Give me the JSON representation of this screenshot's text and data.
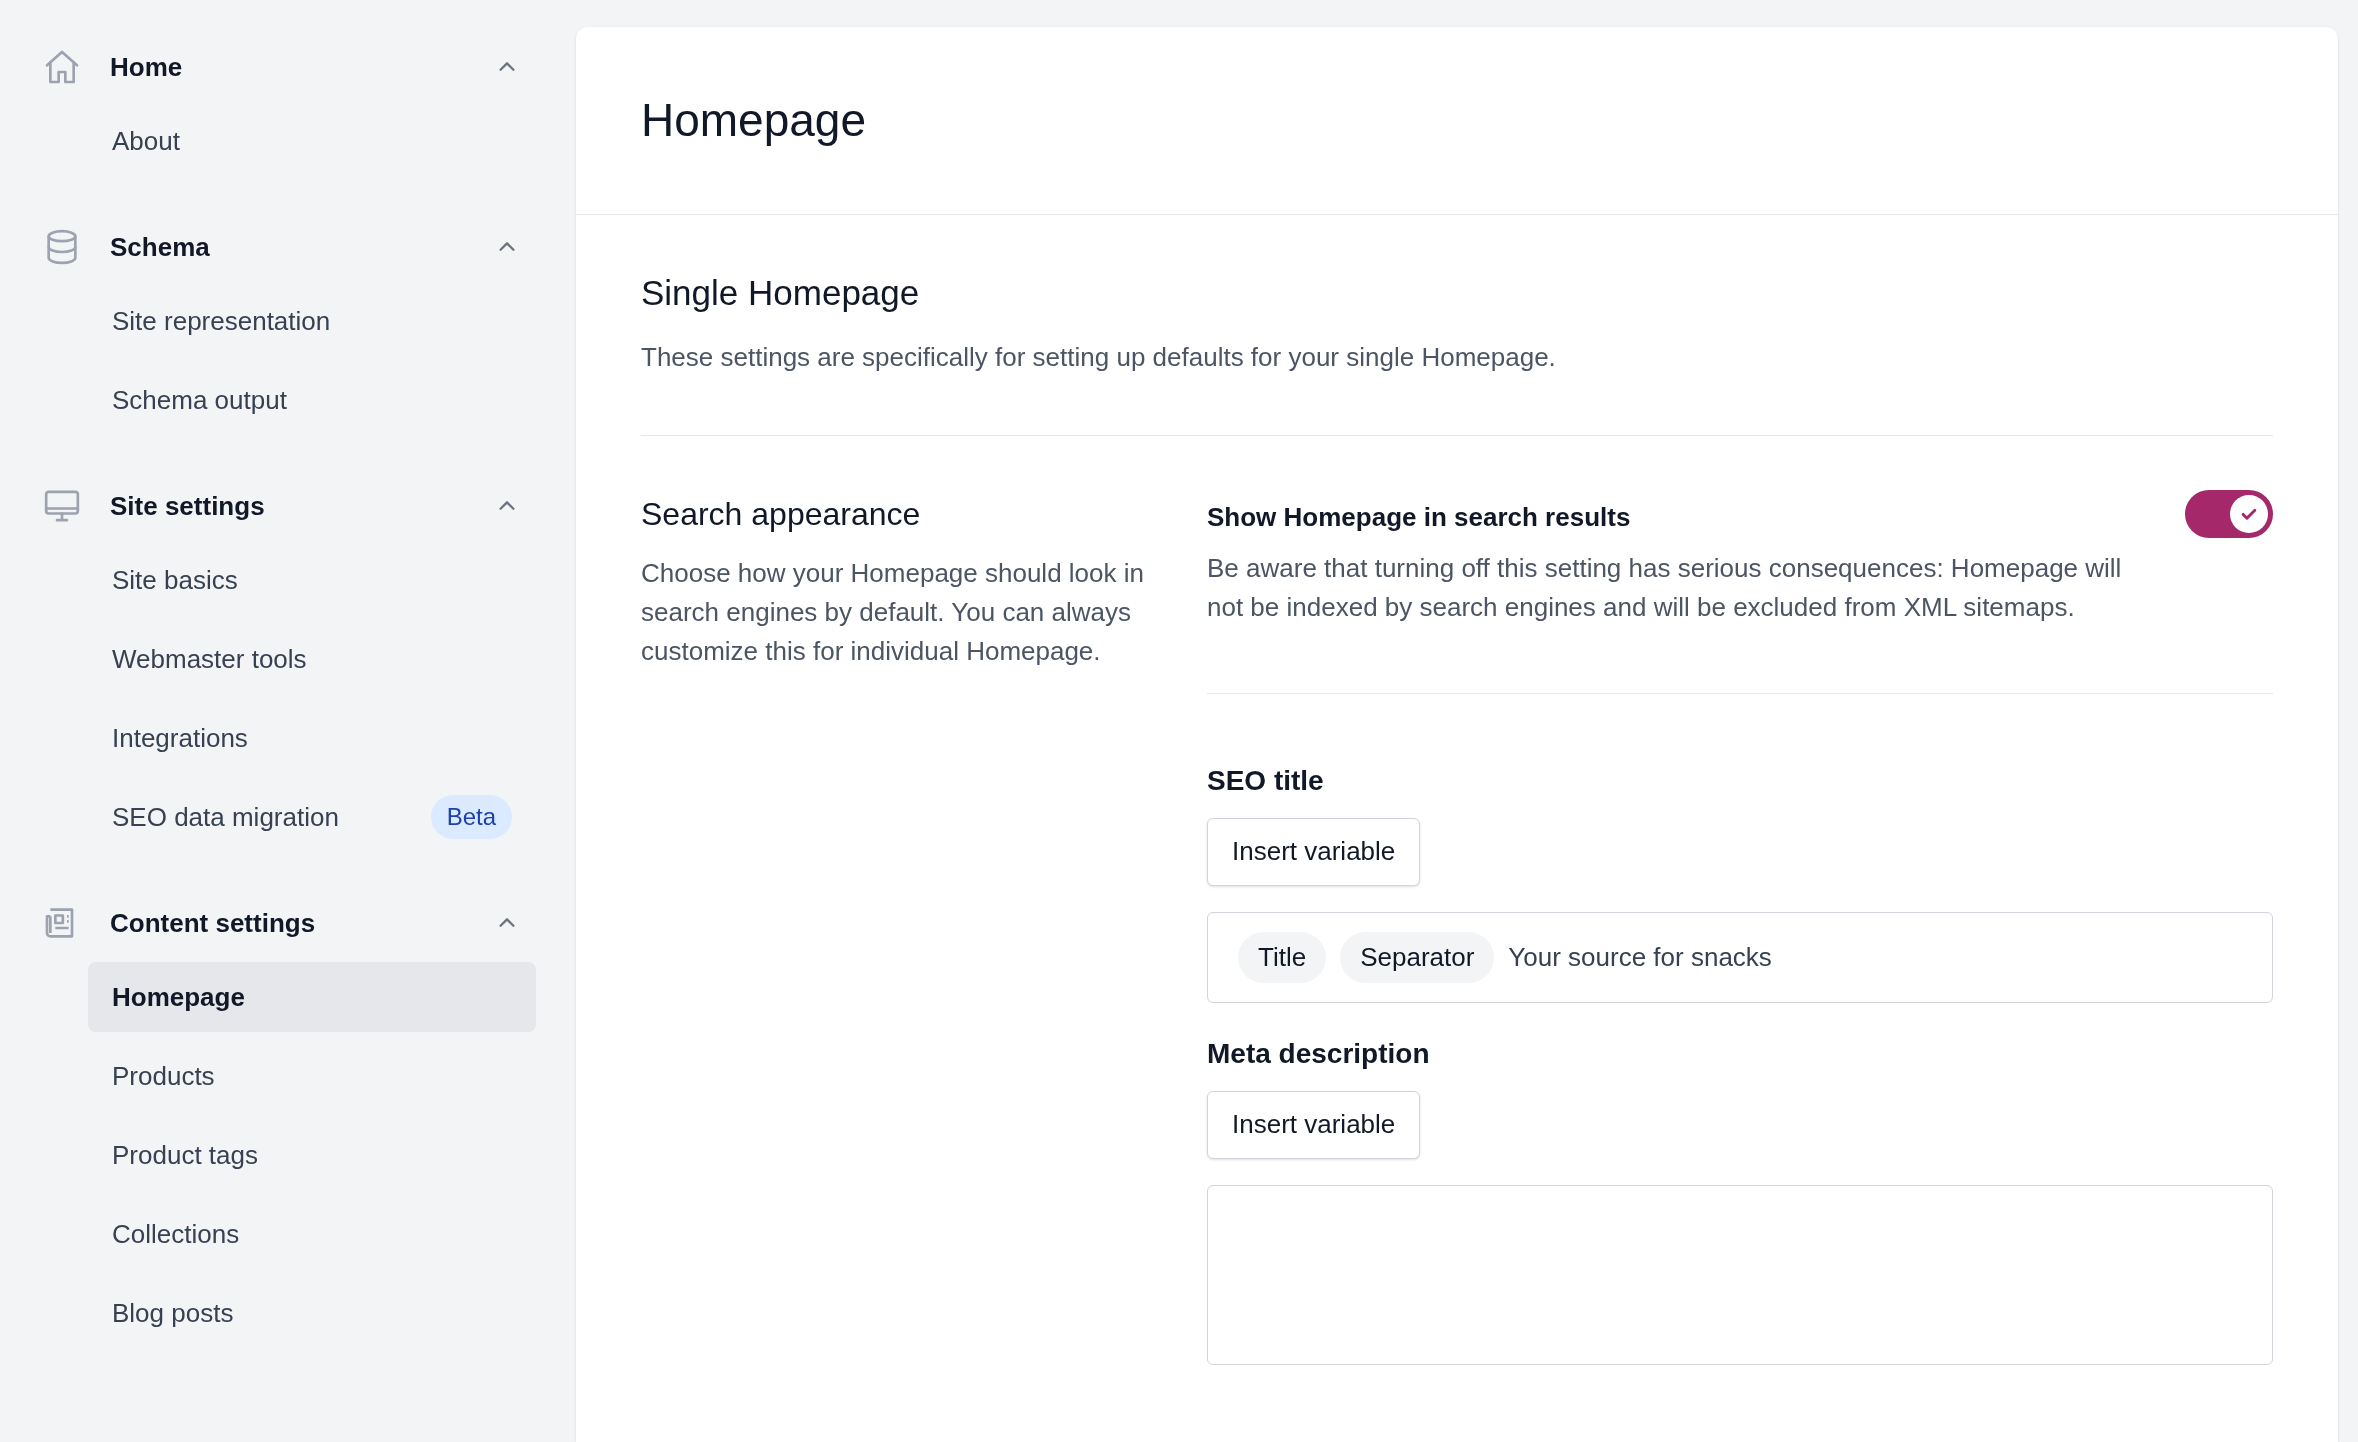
{
  "sidebar": {
    "groups": [
      {
        "label": "Home",
        "expanded": true,
        "items": [
          {
            "label": "About",
            "selected": false
          }
        ]
      },
      {
        "label": "Schema",
        "expanded": true,
        "items": [
          {
            "label": "Site representation",
            "selected": false
          },
          {
            "label": "Schema output",
            "selected": false
          }
        ]
      },
      {
        "label": "Site settings",
        "expanded": true,
        "items": [
          {
            "label": "Site basics",
            "selected": false
          },
          {
            "label": "Webmaster tools",
            "selected": false
          },
          {
            "label": "Integrations",
            "selected": false
          },
          {
            "label": "SEO data migration",
            "selected": false,
            "badge": "Beta"
          }
        ]
      },
      {
        "label": "Content settings",
        "expanded": true,
        "items": [
          {
            "label": "Homepage",
            "selected": true
          },
          {
            "label": "Products",
            "selected": false
          },
          {
            "label": "Product tags",
            "selected": false
          },
          {
            "label": "Collections",
            "selected": false
          },
          {
            "label": "Blog posts",
            "selected": false
          }
        ]
      }
    ]
  },
  "main": {
    "title": "Homepage",
    "section_title": "Single Homepage",
    "section_description": "These settings are specifically for setting up defaults for your single Homepage.",
    "setting": {
      "title": "Search appearance",
      "description": "Choose how your Homepage should look in search engines by default. You can always customize this for individual Homepage.",
      "toggle": {
        "label": "Show Homepage in search results",
        "description": "Be aware that turning off this setting has serious consequences: Homepage will not be indexed by search engines and will be excluded from XML sitemaps.",
        "on": true
      },
      "fields": [
        {
          "label": "SEO title",
          "button": "Insert variable",
          "kind": "input",
          "chips": [
            "Title",
            "Separator"
          ],
          "value": "Your source for snacks"
        },
        {
          "label": "Meta description",
          "button": "Insert variable",
          "kind": "textarea"
        }
      ]
    }
  }
}
